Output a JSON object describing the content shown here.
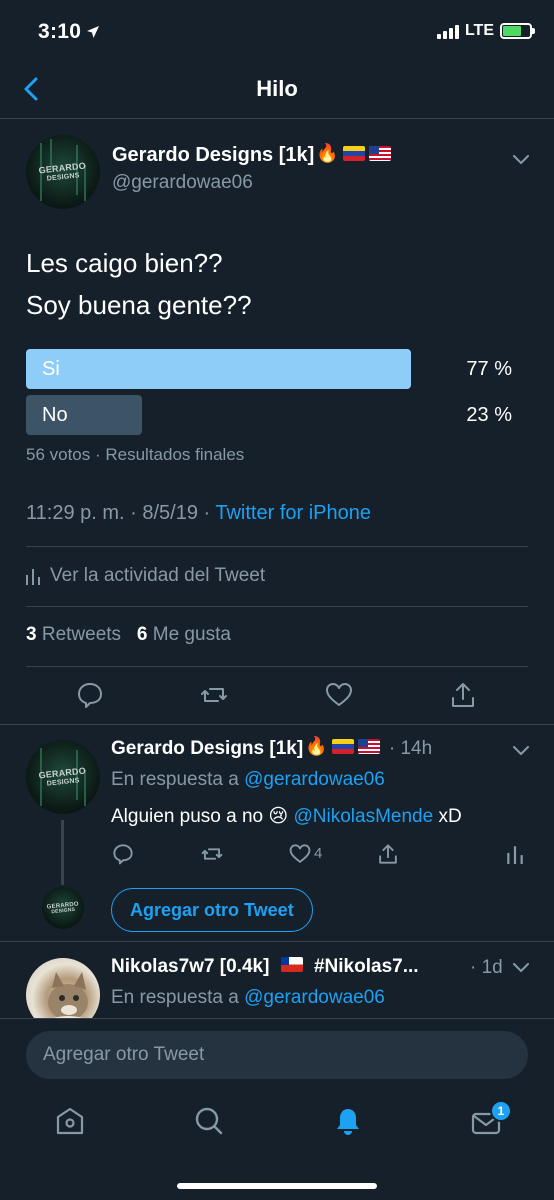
{
  "status_bar": {
    "time": "3:10",
    "network": "LTE"
  },
  "header": {
    "title": "Hilo"
  },
  "main_tweet": {
    "author_name": "Gerardo Designs [1k]",
    "handle": "@gerardowae06",
    "avatar_text_1": "GERARDO",
    "avatar_text_2": "DESIGNS",
    "text_line_1": "Les caigo bien??",
    "text_line_2": "Soy buena gente??",
    "poll": {
      "options": [
        {
          "label": "Si",
          "percent_label": "77 %",
          "fraction": 0.77
        },
        {
          "label": "No",
          "percent_label": "23 %",
          "fraction": 0.23
        }
      ],
      "meta": "56 votos · Resultados finales"
    },
    "timestamp": "11:29 p. m. · 8/5/19 · ",
    "source": "Twitter for iPhone",
    "activity_label": "Ver la actividad del Tweet",
    "retweets_count": "3",
    "retweets_label": " Retweets",
    "likes_count": "6",
    "likes_label": " Me gusta"
  },
  "reply_tweet": {
    "author_name": "Gerardo Designs [1k]",
    "time": "· 14h",
    "reply_prefix": "En respuesta a ",
    "reply_to": "@gerardowae06",
    "text_prefix": "Alguien puso a no ",
    "mention": "@NikolasMende",
    "text_suffix": " xD",
    "likes_count": "4"
  },
  "add_tweet_button": "Agregar otro Tweet",
  "third_tweet": {
    "author_name": "Nikolas7w7 [0.4k]",
    "author_suffix": "#Nikolas7...",
    "time": "· 1d",
    "reply_prefix": "En respuesta a ",
    "reply_to": "@gerardowae06"
  },
  "compose": {
    "placeholder": "Agregar otro Tweet"
  },
  "tab_bar": {
    "messages_badge": "1"
  },
  "colors": {
    "background": "#15202b",
    "accent": "#1da1f2",
    "poll_winner": "#8ecdf8",
    "poll_loser": "#3d5466"
  }
}
